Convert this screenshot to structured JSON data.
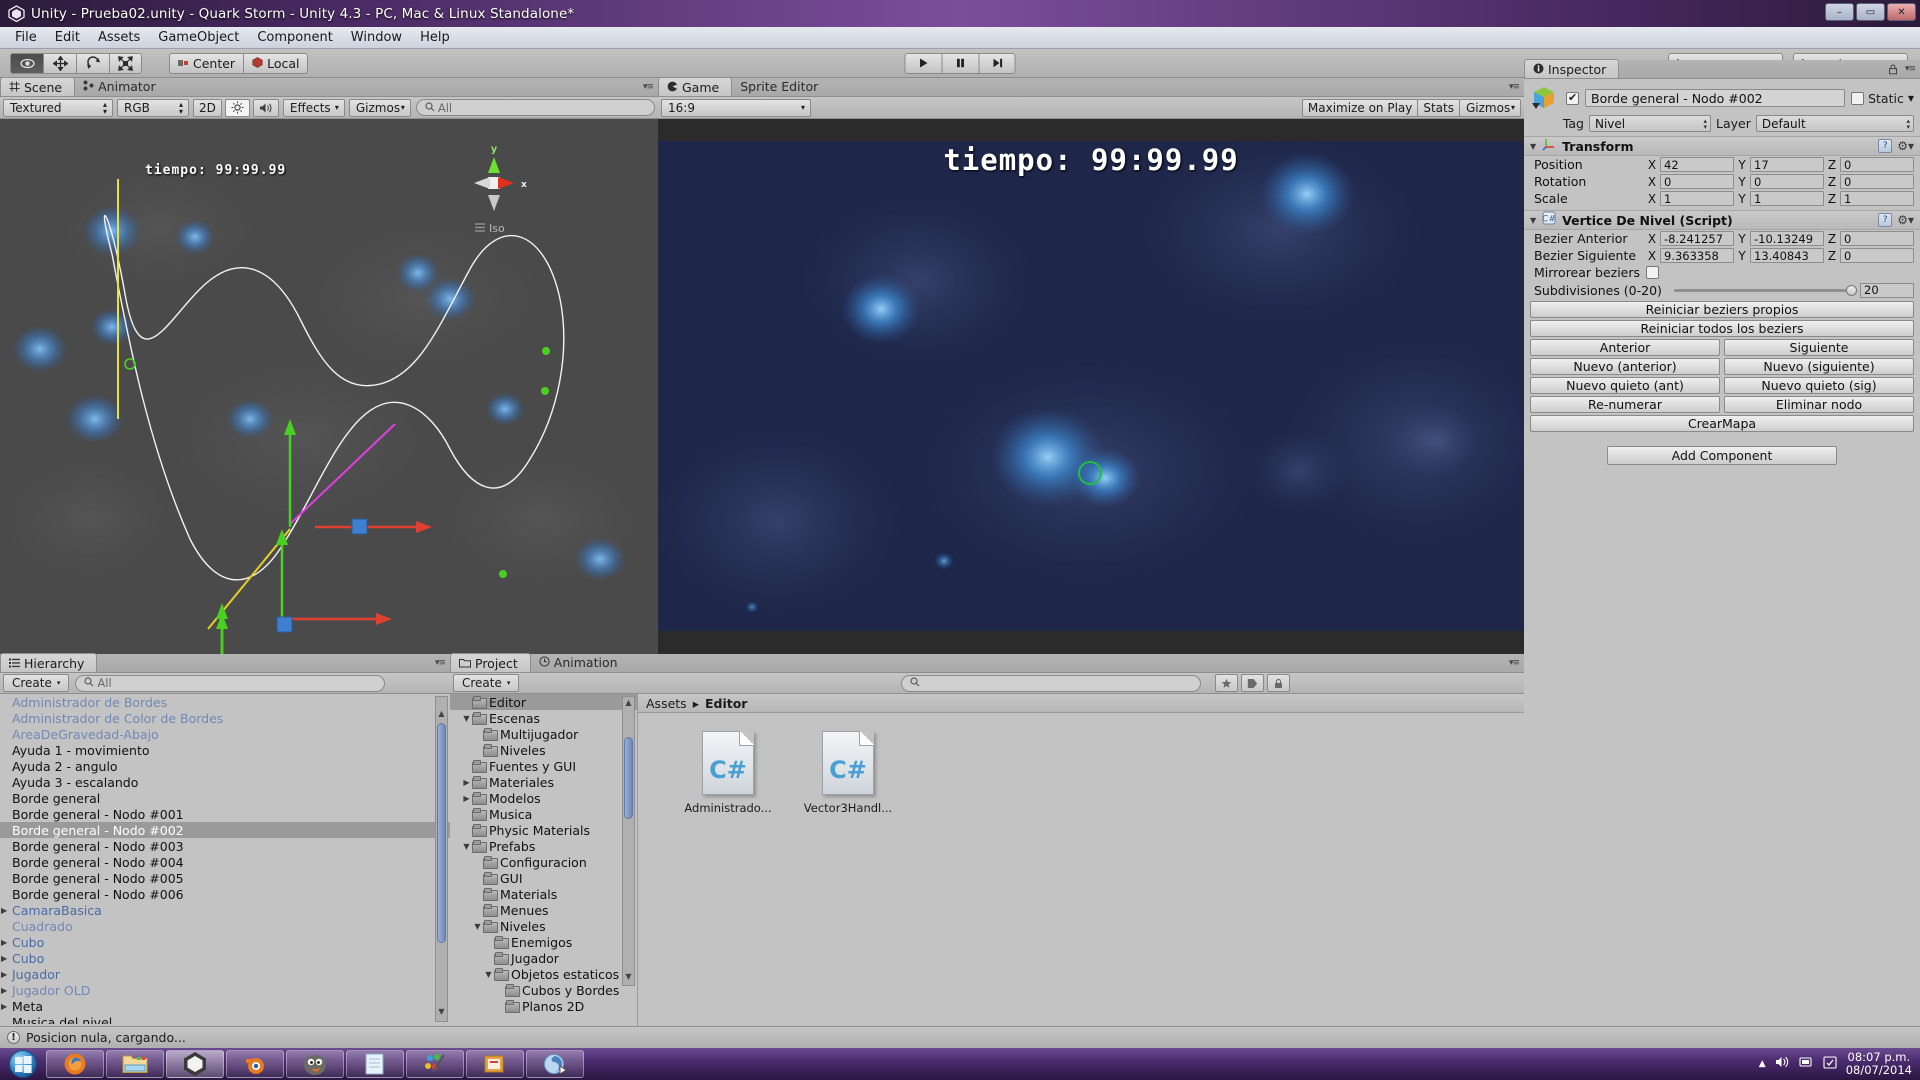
{
  "window": {
    "title": "Unity - Prueba02.unity - Quark Storm - Unity 4.3 - PC, Mac & Linux Standalone*",
    "minimize": "–",
    "maximize": "▭",
    "close": "✕"
  },
  "menubar": {
    "items": [
      "File",
      "Edit",
      "Assets",
      "GameObject",
      "Component",
      "Window",
      "Help"
    ]
  },
  "toolbar": {
    "tools": [
      {
        "name": "hand-tool",
        "glyph": "✋"
      },
      {
        "name": "move-tool",
        "glyph": "✥"
      },
      {
        "name": "rotate-tool",
        "glyph": "⟳"
      },
      {
        "name": "scale-tool",
        "glyph": "⤢"
      }
    ],
    "pivot_label": "Center",
    "space_label": "Local",
    "play": "▶",
    "pause": "❚❚",
    "step": "▶❙",
    "layers_label": "Layers",
    "layout_label": "Layout"
  },
  "scene_panel": {
    "tabs": [
      {
        "label": "Scene",
        "active": true,
        "icon": "grid-icon"
      },
      {
        "label": "Animator",
        "active": false,
        "icon": "animator-icon"
      }
    ],
    "draw_mode": "Textured",
    "color_mode": "RGB",
    "view_2d": "2D",
    "lighting_icon": "sun-icon",
    "audio_icon": "speaker-icon",
    "effects_label": "Effects",
    "gizmos_label": "Gizmos",
    "search_placeholder": "All",
    "overlay_text": "tiempo: 99:99.99",
    "axis_gizmo": {
      "y": "y",
      "x": "x",
      "mode": "Iso"
    }
  },
  "game_panel": {
    "tabs": [
      {
        "label": "Game",
        "active": true,
        "icon": "game-icon"
      },
      {
        "label": "Sprite Editor",
        "active": false,
        "icon": "sprite-icon"
      }
    ],
    "aspect": "16:9",
    "maximize_on_play": "Maximize on Play",
    "stats": "Stats",
    "gizmos": "Gizmos",
    "hud_time": "tiempo: 99:99.99"
  },
  "hierarchy": {
    "tab_label": "Hierarchy",
    "create_label": "Create",
    "search_placeholder": "All",
    "items": [
      {
        "label": "Administrador de Bordes",
        "style": "prefab-dim",
        "expand": false,
        "selected": false
      },
      {
        "label": "Administrador de Color de Bordes",
        "style": "prefab-dim",
        "expand": false,
        "selected": false
      },
      {
        "label": "AreaDeGravedad-Abajo",
        "style": "prefab-dim",
        "expand": false,
        "selected": false
      },
      {
        "label": "Ayuda 1 - movimiento",
        "style": "normal",
        "expand": false,
        "selected": false
      },
      {
        "label": "Ayuda 2 - angulo",
        "style": "normal",
        "expand": false,
        "selected": false
      },
      {
        "label": "Ayuda 3 - escalando",
        "style": "normal",
        "expand": false,
        "selected": false
      },
      {
        "label": "Borde general",
        "style": "normal",
        "expand": false,
        "selected": false
      },
      {
        "label": "Borde general - Nodo #001",
        "style": "normal",
        "expand": false,
        "selected": false
      },
      {
        "label": "Borde general - Nodo #002",
        "style": "normal",
        "expand": false,
        "selected": true
      },
      {
        "label": "Borde general - Nodo #003",
        "style": "normal",
        "expand": false,
        "selected": false
      },
      {
        "label": "Borde general - Nodo #004",
        "style": "normal",
        "expand": false,
        "selected": false
      },
      {
        "label": "Borde general - Nodo #005",
        "style": "normal",
        "expand": false,
        "selected": false
      },
      {
        "label": "Borde general - Nodo #006",
        "style": "normal",
        "expand": false,
        "selected": false
      },
      {
        "label": "CamaraBasica",
        "style": "prefab",
        "expand": true,
        "selected": false
      },
      {
        "label": "Cuadrado",
        "style": "prefab-dim",
        "expand": false,
        "selected": false
      },
      {
        "label": "Cubo",
        "style": "prefab",
        "expand": true,
        "selected": false
      },
      {
        "label": "Cubo",
        "style": "prefab",
        "expand": true,
        "selected": false
      },
      {
        "label": "Jugador",
        "style": "prefab",
        "expand": true,
        "selected": false
      },
      {
        "label": "Jugador OLD",
        "style": "prefab-dim",
        "expand": true,
        "selected": false
      },
      {
        "label": "Meta",
        "style": "normal",
        "expand": true,
        "selected": false
      },
      {
        "label": "Musica del nivel",
        "style": "normal",
        "expand": false,
        "selected": false
      }
    ]
  },
  "project": {
    "tabs": [
      {
        "label": "Project",
        "active": true,
        "icon": "folder-icon"
      },
      {
        "label": "Animation",
        "active": false,
        "icon": "clock-icon"
      }
    ],
    "create_label": "Create",
    "search_placeholder": "",
    "breadcrumb": {
      "root": "Assets",
      "separator": "▸",
      "current": "Editor"
    },
    "tree": [
      {
        "label": "Editor",
        "indent": 1,
        "tri": "",
        "selected": true
      },
      {
        "label": "Escenas",
        "indent": 1,
        "tri": "▼",
        "selected": false
      },
      {
        "label": "Multijugador",
        "indent": 2,
        "tri": "",
        "selected": false
      },
      {
        "label": "Niveles",
        "indent": 2,
        "tri": "",
        "selected": false
      },
      {
        "label": "Fuentes y GUI",
        "indent": 1,
        "tri": "",
        "selected": false
      },
      {
        "label": "Materiales",
        "indent": 1,
        "tri": "▶",
        "selected": false
      },
      {
        "label": "Modelos",
        "indent": 1,
        "tri": "▶",
        "selected": false
      },
      {
        "label": "Musica",
        "indent": 1,
        "tri": "",
        "selected": false
      },
      {
        "label": "Physic Materials",
        "indent": 1,
        "tri": "",
        "selected": false
      },
      {
        "label": "Prefabs",
        "indent": 1,
        "tri": "▼",
        "selected": false
      },
      {
        "label": "Configuracion",
        "indent": 2,
        "tri": "",
        "selected": false
      },
      {
        "label": "GUI",
        "indent": 2,
        "tri": "",
        "selected": false
      },
      {
        "label": "Materials",
        "indent": 2,
        "tri": "",
        "selected": false
      },
      {
        "label": "Menues",
        "indent": 2,
        "tri": "",
        "selected": false
      },
      {
        "label": "Niveles",
        "indent": 2,
        "tri": "▼",
        "selected": false
      },
      {
        "label": "Enemigos",
        "indent": 3,
        "tri": "",
        "selected": false
      },
      {
        "label": "Jugador",
        "indent": 3,
        "tri": "",
        "selected": false
      },
      {
        "label": "Objetos estaticos",
        "indent": 3,
        "tri": "▼",
        "selected": false
      },
      {
        "label": "Cubos y Bordes",
        "indent": 4,
        "tri": "",
        "selected": false
      },
      {
        "label": "Planos 2D",
        "indent": 4,
        "tri": "",
        "selected": false
      }
    ],
    "assets": [
      {
        "name": "Administrado...",
        "type": "C#"
      },
      {
        "name": "Vector3Handl...",
        "type": "C#"
      }
    ]
  },
  "inspector": {
    "tab_label": "Inspector",
    "object_name": "Borde general - Nodo #002",
    "enabled": true,
    "static_label": "Static",
    "tag_label": "Tag",
    "tag_value": "Nivel",
    "layer_label": "Layer",
    "layer_value": "Default",
    "transform": {
      "title": "Transform",
      "rows": [
        {
          "label": "Position",
          "x": "42",
          "y": "17",
          "z": "0"
        },
        {
          "label": "Rotation",
          "x": "0",
          "y": "0",
          "z": "0"
        },
        {
          "label": "Scale",
          "x": "1",
          "y": "1",
          "z": "1"
        }
      ]
    },
    "script": {
      "title": "Vertice De Nivel (Script)",
      "rows": [
        {
          "label": "Bezier Anterior",
          "x": "-8.241257",
          "y": "-10.13249",
          "z": "0"
        },
        {
          "label": "Bezier Siguiente",
          "x": "9.363358",
          "y": "13.40843",
          "z": "0"
        }
      ],
      "mirror_label": "Mirrorear beziers",
      "mirror_checked": false,
      "subdiv_label": "Subdivisiones (0-20)",
      "subdiv_value": "20",
      "buttons_full": [
        "Reiniciar beziers propios",
        "Reiniciar todos los beziers"
      ],
      "buttons_pairs": [
        [
          "Anterior",
          "Siguiente"
        ],
        [
          "Nuevo (anterior)",
          "Nuevo (siguiente)"
        ],
        [
          "Nuevo quieto (ant)",
          "Nuevo quieto (sig)"
        ],
        [
          "Re-numerar",
          "Eliminar nodo"
        ]
      ],
      "button_crearmapa": "CrearMapa"
    },
    "add_component": "Add Component",
    "axis_labels": {
      "x": "X",
      "y": "Y",
      "z": "Z"
    }
  },
  "status_bar": {
    "message": "Posicion nula, cargando...",
    "icon": "warning-icon"
  },
  "taskbar": {
    "start": "start-orb",
    "items": [
      {
        "name": "firefox",
        "glyph": "🦊"
      },
      {
        "name": "file-explorer",
        "glyph": "📁"
      },
      {
        "name": "unity",
        "glyph": "◆",
        "active": true
      },
      {
        "name": "blender",
        "glyph": "◉"
      },
      {
        "name": "gimp",
        "glyph": "🐺"
      },
      {
        "name": "notepad",
        "glyph": "📄"
      },
      {
        "name": "paint",
        "glyph": "🎨"
      },
      {
        "name": "office",
        "glyph": "📑"
      },
      {
        "name": "media",
        "glyph": "◎"
      }
    ],
    "tray": {
      "up_arrow": "▲",
      "volume": "🔊",
      "network": "▤",
      "action": "▣"
    },
    "clock_time": "08:07 p.m.",
    "clock_date": "08/07/2014"
  },
  "colors": {
    "accent_blue": "#4a6ba8",
    "selection_gray": "#9a9a9a",
    "axis_x": "#d43b2f",
    "axis_y": "#5ed12a",
    "axis_z": "#2a6bd1",
    "bezier_magenta": "#e040e0",
    "game_bg": "#232c52"
  }
}
